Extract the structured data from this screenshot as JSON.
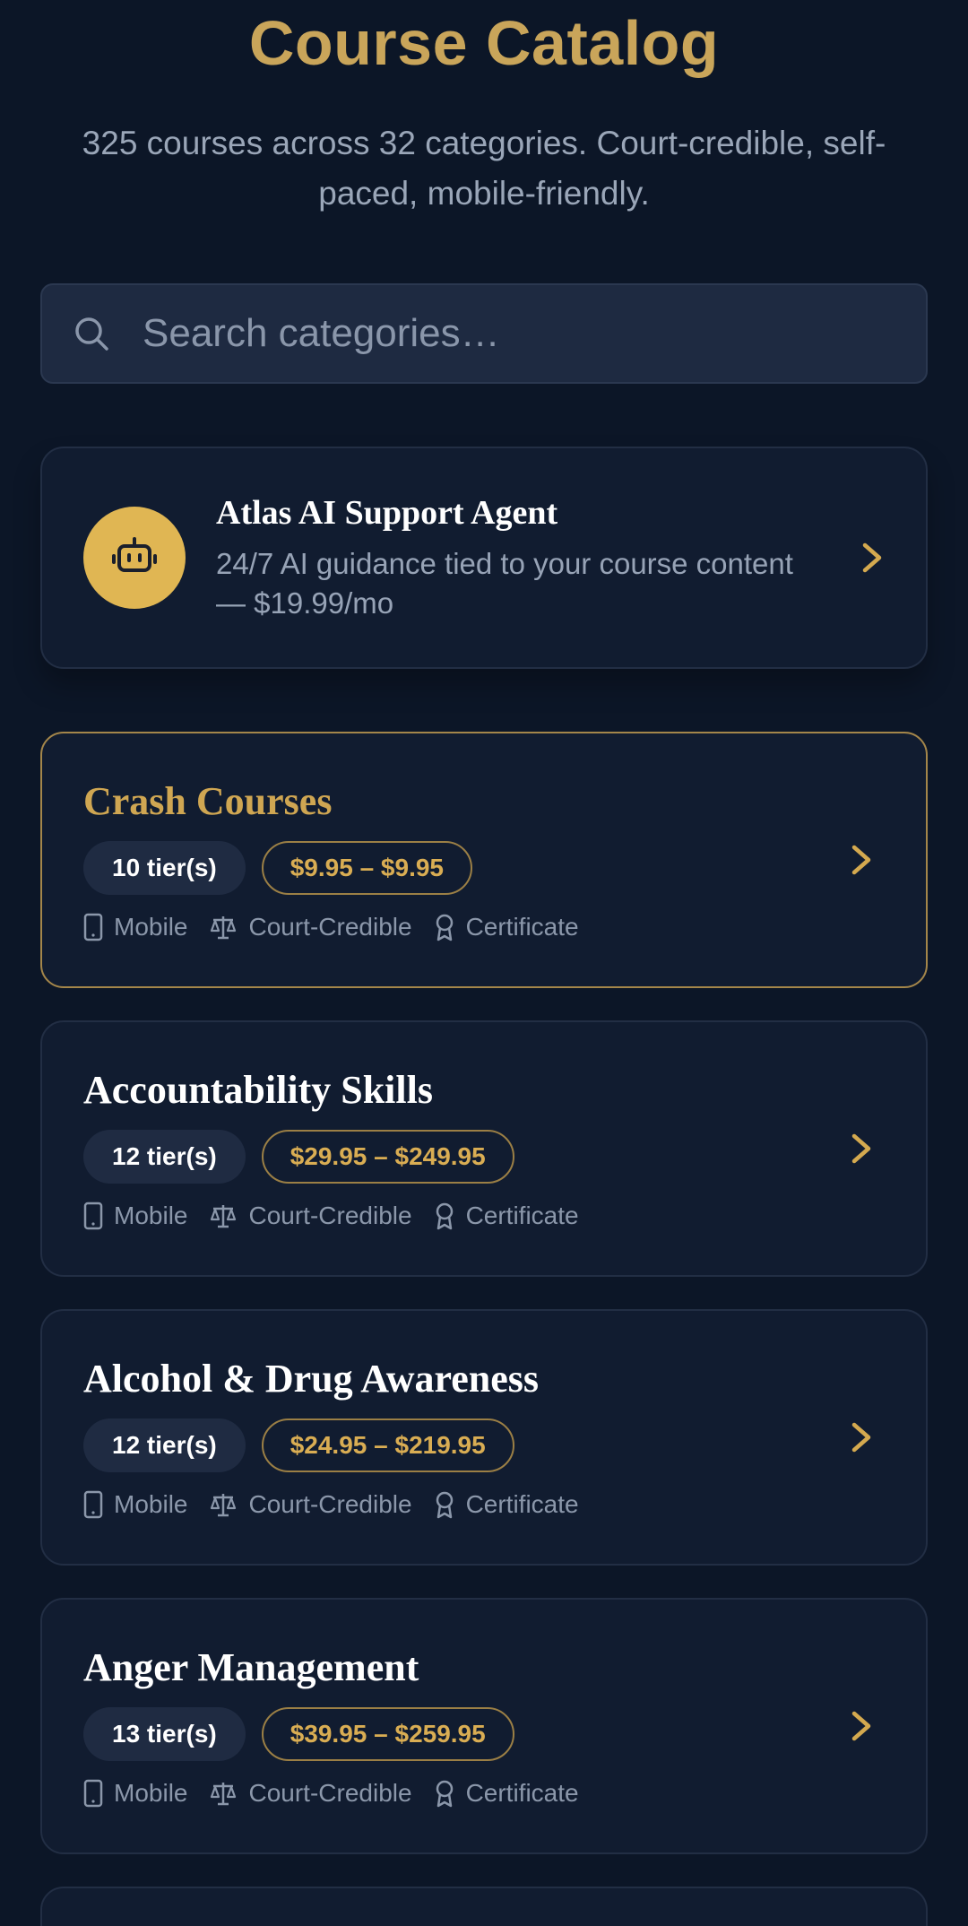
{
  "header": {
    "title": "Course Catalog",
    "subtitle": "325 courses across 32 categories. Court-credible, self-paced, mobile-friendly."
  },
  "search": {
    "placeholder": "Search categories…",
    "icon": "search-icon"
  },
  "ai_card": {
    "title": "Atlas AI Support Agent",
    "description": "24/7 AI guidance tied to your course content — $19.99/mo",
    "icon": "robot-icon"
  },
  "features": {
    "mobile": "Mobile",
    "court": "Court-Credible",
    "certificate": "Certificate"
  },
  "categories": [
    {
      "title": "Crash Courses",
      "tiers": "10 tier(s)",
      "price": "$9.95 – $9.95",
      "highlighted": true
    },
    {
      "title": "Accountability Skills",
      "tiers": "12 tier(s)",
      "price": "$29.95 – $249.95",
      "highlighted": false
    },
    {
      "title": "Alcohol & Drug Awareness",
      "tiers": "12 tier(s)",
      "price": "$24.95 – $219.95",
      "highlighted": false
    },
    {
      "title": "Anger Management",
      "tiers": "13 tier(s)",
      "price": "$39.95 – $259.95",
      "highlighted": false
    }
  ],
  "colors": {
    "background": "#0c1627",
    "card": "#111c30",
    "accent_gold": "#c9a55a",
    "highlight_border": "#a4864a",
    "muted_text": "#8b97aa"
  }
}
